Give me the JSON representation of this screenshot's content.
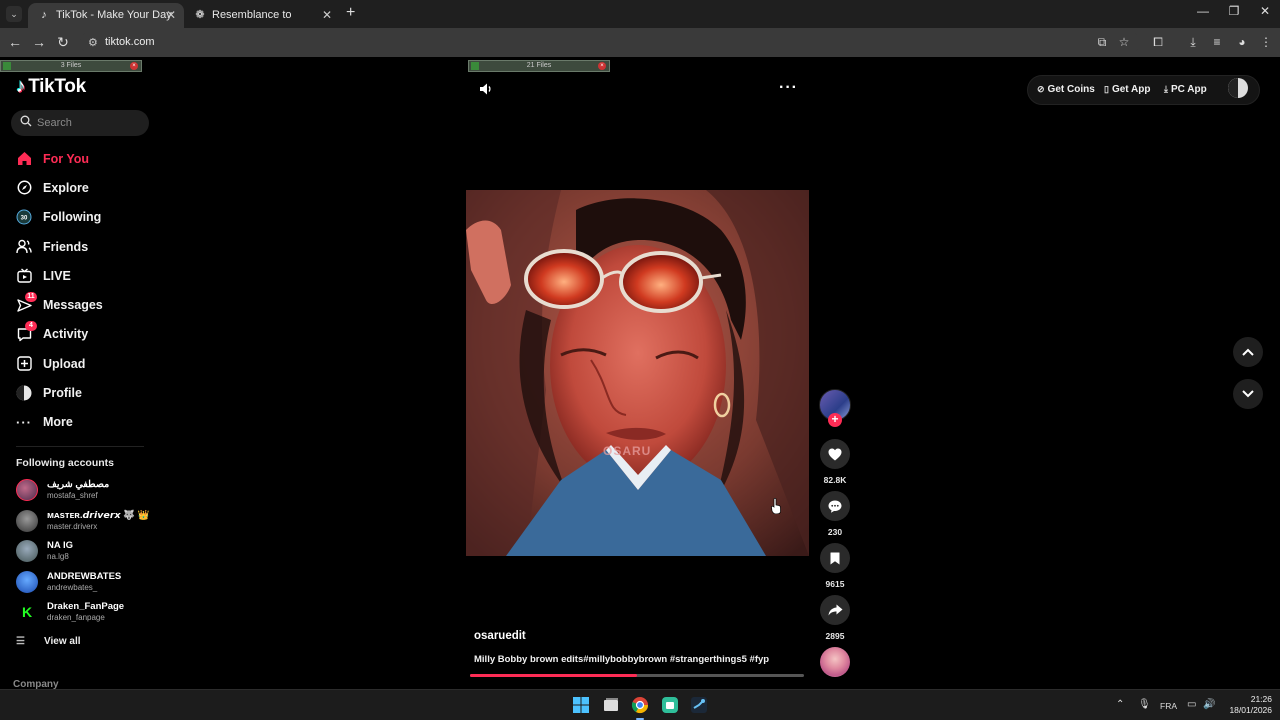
{
  "browser": {
    "tabs": [
      {
        "title": "TikTok - Make Your Day",
        "icon": "tiktok-icon",
        "active": true
      },
      {
        "title": "Resemblance to Higuruma",
        "icon": "openai-icon",
        "active": false
      }
    ],
    "url": "tiktok.com"
  },
  "downloads": [
    {
      "label": "3 Files"
    },
    {
      "label": "21 Files"
    }
  ],
  "sidebar": {
    "logo": "TikTok",
    "search_placeholder": "Search",
    "nav": [
      {
        "label": "For You",
        "icon": "home-icon",
        "active": true
      },
      {
        "label": "Explore",
        "icon": "compass-icon"
      },
      {
        "label": "Following",
        "icon": "following-icon"
      },
      {
        "label": "Friends",
        "icon": "friends-icon"
      },
      {
        "label": "LIVE",
        "icon": "live-icon"
      },
      {
        "label": "Messages",
        "icon": "messages-icon",
        "badge": "11"
      },
      {
        "label": "Activity",
        "icon": "activity-icon",
        "badge": "4"
      },
      {
        "label": "Upload",
        "icon": "upload-icon"
      },
      {
        "label": "Profile",
        "icon": "profile-icon"
      },
      {
        "label": "More",
        "icon": "more-icon"
      }
    ],
    "following_heading": "Following accounts",
    "accounts": [
      {
        "name": "مصطفي شريف",
        "handle": "mostafa_shref",
        "avatar_color": "#7a3a6a"
      },
      {
        "name": "ᴍᴀsᴛᴇʀ.𝙙𝙧𝙞𝙫𝙚𝙧𝙭 🐺 👑",
        "handle": "master.driverx",
        "avatar_color": "#555555"
      },
      {
        "name": "NA IG",
        "handle": "na.lg8",
        "avatar_color": "#6a8a9a"
      },
      {
        "name": "ANDREWBATES",
        "handle": "andrewbates_",
        "avatar_color": "#2a6ad0"
      },
      {
        "name": "Draken_FanPage",
        "handle": "draken_fanpage",
        "avatar_color": "#1a1a1a"
      }
    ],
    "view_all": "View all",
    "company": "Company"
  },
  "video": {
    "watermark": "OSARU",
    "username": "osaruedit",
    "caption": "Milly Bobby brown edits#millybobbybrown #strangerthings5 #fyp",
    "progress": 0.5,
    "likes": "82.8K",
    "comments": "230",
    "saves": "9615",
    "shares": "2895"
  },
  "top_actions": {
    "coins": "Get Coins",
    "app": "Get App",
    "pc_app": "PC App"
  },
  "taskbar": {
    "lang": "FRA",
    "time": "21:26",
    "date": "18/01/2026"
  },
  "colors": {
    "brand": "#fe2c55",
    "background": "#000000",
    "sidebar_search": "#1f1f1f"
  }
}
